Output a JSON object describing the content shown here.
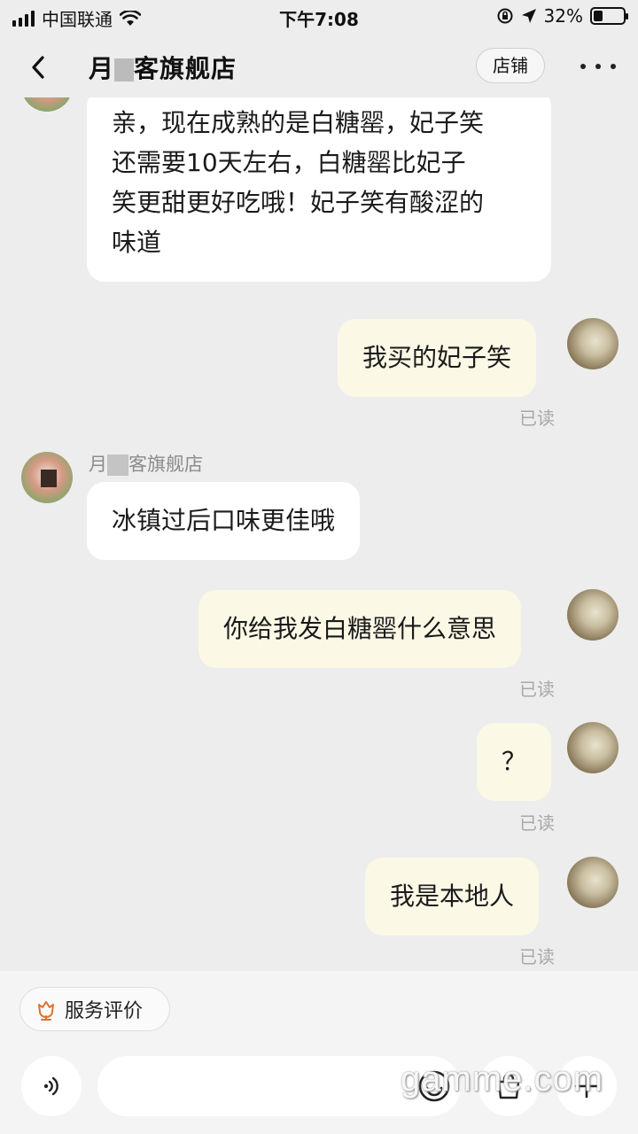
{
  "status_bar": {
    "carrier": "中国联通",
    "time": "下午7:08",
    "battery_percent_text": "32%",
    "battery_level": 0.32
  },
  "header": {
    "title_start": "月",
    "title_end": "客旗舰店",
    "shop_button": "店铺"
  },
  "messages": [
    {
      "from": "shop",
      "lines": [
        "亲，现在成熟的是白糖罂，妃子笑",
        "还需要10天左右，白糖罂比妃子",
        "笑更甜更好吃哦！妃子笑有酸涩的",
        "味道"
      ]
    },
    {
      "from": "me",
      "lines": [
        "我买的妃子笑"
      ],
      "status": "已读"
    },
    {
      "from": "shop",
      "sender_start": "月",
      "sender_end": "客旗舰店",
      "lines": [
        "冰镇过后口味更佳哦"
      ]
    },
    {
      "from": "me",
      "lines": [
        "你给我发白糖罂什么意思"
      ],
      "status": "已读"
    },
    {
      "from": "me",
      "lines": [
        "？"
      ],
      "status": "已读"
    },
    {
      "from": "me",
      "lines": [
        "我是本地人"
      ],
      "status": "已读"
    }
  ],
  "bottom": {
    "review_chip": "服务评价",
    "input_placeholder": ""
  },
  "watermark": "gamme.com",
  "colors": {
    "background": "#ededed",
    "incoming_bubble": "#ffffff",
    "outgoing_bubble": "#fbf8e6",
    "read_text": "#a8a8a8",
    "review_icon": "#e0702a"
  }
}
